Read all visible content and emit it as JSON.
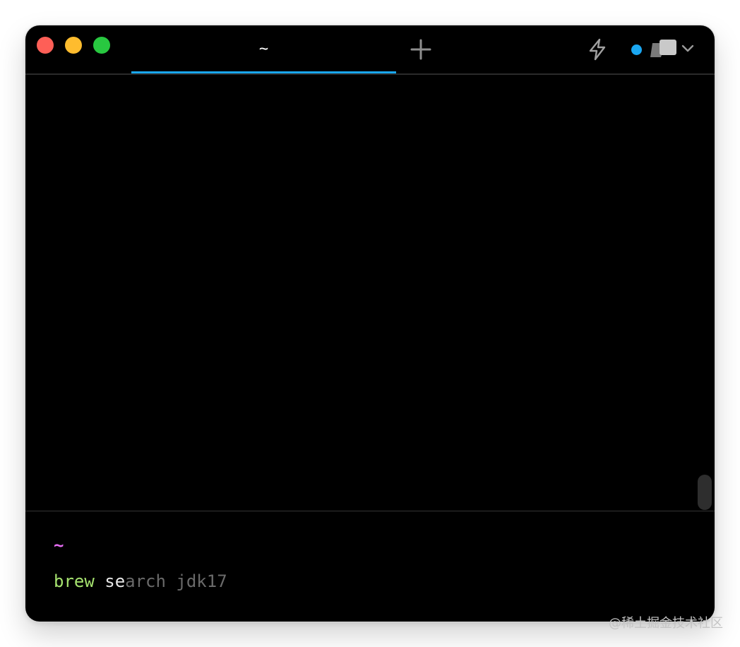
{
  "window": {
    "tab": {
      "label": "~"
    },
    "colors": {
      "accent": "#1aa7f2",
      "close": "#fe5f57",
      "minimize": "#febc2e",
      "maximize": "#28c840"
    },
    "icons": {
      "new_tab": "plus-icon",
      "workflows": "lightning-bolt-icon",
      "status": "status-dot-icon",
      "workspace": "workspace-icon",
      "menu": "chevron-down-icon"
    }
  },
  "terminal": {
    "prompt": "~",
    "command": {
      "name": "brew",
      "typed": " se",
      "suggestion": "arch jdk17"
    },
    "colors": {
      "prompt": "#e46cf2",
      "command": "#a6e36f",
      "suggestion": "#6a6a6a"
    }
  },
  "watermark": "@稀土掘金技术社区"
}
